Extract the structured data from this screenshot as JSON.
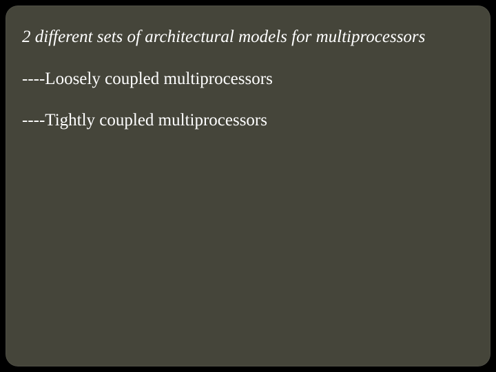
{
  "slide": {
    "heading": "2 different sets of architectural models for multiprocessors",
    "item1": "----Loosely coupled multiprocessors",
    "item2": "----Tightly coupled multiprocessors"
  }
}
